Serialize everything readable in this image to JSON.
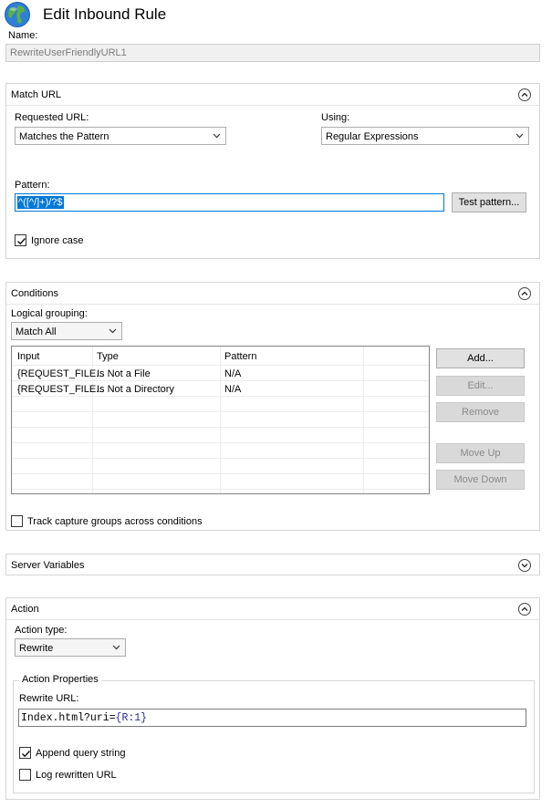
{
  "header": {
    "title": "Edit Inbound Rule",
    "name_label": "Name:",
    "name_value": "RewriteUserFriendlyURL1"
  },
  "match_url": {
    "section_title": "Match URL",
    "requested_url_label": "Requested URL:",
    "requested_url_value": "Matches the Pattern",
    "using_label": "Using:",
    "using_value": "Regular Expressions",
    "pattern_label": "Pattern:",
    "pattern_value": "^([^/]+)/?$",
    "test_pattern_button": "Test pattern...",
    "ignore_case_label": "Ignore case",
    "ignore_case_checked": true
  },
  "conditions": {
    "section_title": "Conditions",
    "logical_grouping_label": "Logical grouping:",
    "logical_grouping_value": "Match All",
    "columns": [
      "Input",
      "Type",
      "Pattern"
    ],
    "rows": [
      {
        "input": "{REQUEST_FILE...",
        "type": "Is Not a File",
        "pattern": "N/A"
      },
      {
        "input": "{REQUEST_FILE...",
        "type": "Is Not a Directory",
        "pattern": "N/A"
      }
    ],
    "buttons": {
      "add": "Add...",
      "edit": "Edit...",
      "remove": "Remove",
      "move_up": "Move Up",
      "move_down": "Move Down"
    },
    "track_label": "Track capture groups across conditions",
    "track_checked": false
  },
  "server_variables": {
    "section_title": "Server Variables"
  },
  "action": {
    "section_title": "Action",
    "action_type_label": "Action type:",
    "action_type_value": "Rewrite",
    "properties_legend": "Action Properties",
    "rewrite_url_label": "Rewrite URL:",
    "rewrite_url_prefix": "Index.html?uri=",
    "rewrite_url_open": "{",
    "rewrite_url_var": "R:1",
    "rewrite_url_close": "}",
    "append_query_label": "Append query string",
    "append_query_checked": true,
    "log_rewritten_label": "Log rewritten URL",
    "log_rewritten_checked": false
  },
  "colors": {
    "selection": "#0078d7",
    "accent_border": "#0078d7",
    "panel_border": "#d6d6d6"
  }
}
